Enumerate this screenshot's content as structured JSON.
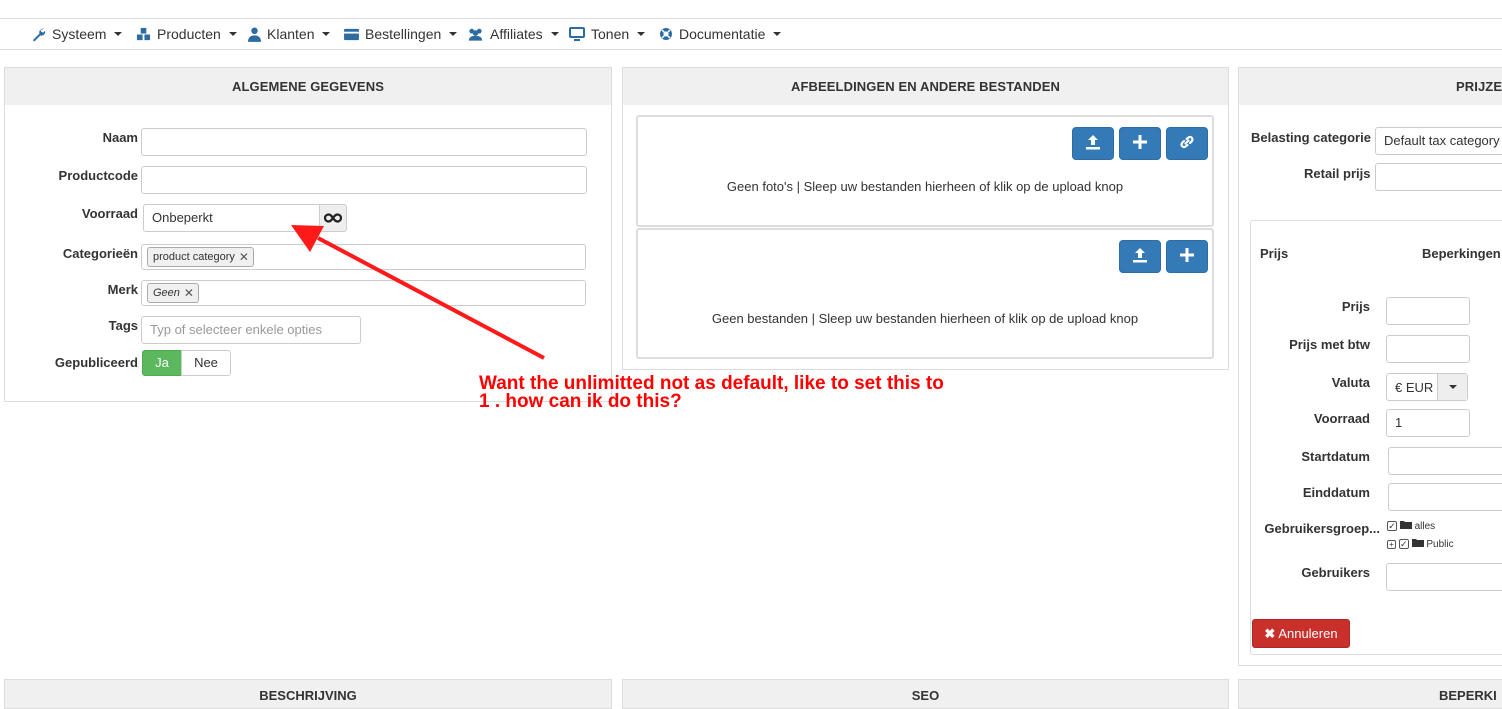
{
  "navbar": {
    "items": [
      {
        "label": "Systeem",
        "icon": "wrench-icon"
      },
      {
        "label": "Producten",
        "icon": "cubes-icon"
      },
      {
        "label": "Klanten",
        "icon": "user-icon"
      },
      {
        "label": "Bestellingen",
        "icon": "credit-card-icon"
      },
      {
        "label": "Affiliates",
        "icon": "users-icon"
      },
      {
        "label": "Tonen",
        "icon": "desktop-icon"
      },
      {
        "label": "Documentatie",
        "icon": "life-ring-icon"
      }
    ]
  },
  "general": {
    "title": "ALGEMENE GEGEVENS",
    "name_label": "Naam",
    "name_value": "",
    "code_label": "Productcode",
    "code_value": "",
    "stock_label": "Voorraad",
    "stock_value": "Onbeperkt",
    "stock_infinity_icon": "infinity-icon",
    "categories_label": "Categorieën",
    "category_chip": "product category",
    "brand_label": "Merk",
    "brand_chip": "Geen",
    "tags_label": "Tags",
    "tags_placeholder": "Typ of selecteer enkele opties",
    "published_label": "Gepubliceerd",
    "published_yes": "Ja",
    "published_no": "Nee",
    "published_selected": "Ja"
  },
  "files": {
    "title": "AFBEELDINGEN EN ANDERE BESTANDEN",
    "photos_empty": "Geen foto's | Sleep uw bestanden hierheen of klik op de upload knop",
    "files_empty": "Geen bestanden | Sleep uw bestanden hierheen of klik op de upload knop"
  },
  "prices": {
    "title": "PRIJZE",
    "tax_label": "Belasting categorie",
    "tax_value": "Default tax category",
    "retail_label": "Retail prijs",
    "retail_value": "",
    "col_price": "Prijs",
    "col_limits": "Beperkingen",
    "price_label": "Prijs",
    "price_value": "",
    "price_vat_label": "Prijs met btw",
    "price_vat_value": "",
    "currency_label": "Valuta",
    "currency_value": "€ EUR",
    "stock_label": "Voorraad",
    "stock_value": "1",
    "start_label": "Startdatum",
    "start_value": "",
    "end_label": "Einddatum",
    "end_value": "",
    "groups_label": "Gebruikersgroep...",
    "group_all": "alles",
    "group_public": "Public",
    "users_label": "Gebruikers",
    "users_value": "",
    "cancel_label": "Annuleren"
  },
  "annotation": {
    "line1": "Want the unlimitted not as default, like to set this to",
    "line2": "1 . how can ik do this?",
    "color": "#ff0000"
  },
  "bottom_panels": [
    "BESCHRIJVING",
    "SEO",
    "BEPERKI"
  ]
}
